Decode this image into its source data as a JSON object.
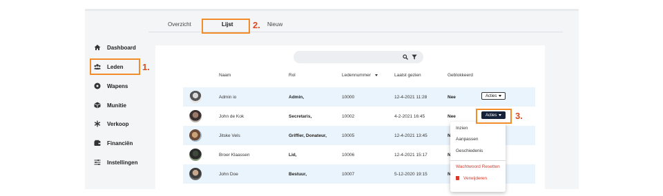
{
  "sidebar": {
    "items": [
      {
        "label": "Dashboard",
        "icon": "home-icon"
      },
      {
        "label": "Leden",
        "icon": "users-icon"
      },
      {
        "label": "Wapens",
        "icon": "target-icon"
      },
      {
        "label": "Munitie",
        "icon": "box-icon"
      },
      {
        "label": "Verkoop",
        "icon": "asterisk-icon"
      },
      {
        "label": "Financiën",
        "icon": "wallet-icon"
      },
      {
        "label": "Instellingen",
        "icon": "sliders-icon"
      }
    ]
  },
  "tabs": [
    {
      "label": "Overzicht"
    },
    {
      "label": "Lijst"
    },
    {
      "label": "Nieuw"
    }
  ],
  "table": {
    "columns": [
      "Naam",
      "Rol",
      "Ledennummer",
      "Laatst gezien",
      "Geblokkeerd"
    ],
    "rows": [
      {
        "name": "Admin io",
        "role": "Admin,",
        "number": "10000",
        "last_seen": "12-4-2021 11:28",
        "blocked": "Nee",
        "actions": "Acties"
      },
      {
        "name": "John de Kok",
        "role": "Secretaris,",
        "number": "10002",
        "last_seen": "4-2-2021 16:45",
        "blocked": "Nee",
        "actions": "Acties"
      },
      {
        "name": "Jitske Vels",
        "role": "Griffier, Donateur,",
        "number": "10005",
        "last_seen": "12-4-2021 13:45",
        "blocked": "N"
      },
      {
        "name": "Broer Klaassen",
        "role": "Lid,",
        "number": "10006",
        "last_seen": "12-4-2021 15:17",
        "blocked": "N"
      },
      {
        "name": "John Doe",
        "role": "Bestuur,",
        "number": "10007",
        "last_seen": "5-12-2020 19:15",
        "blocked": "N"
      }
    ]
  },
  "dropdown": {
    "items": [
      "Inzien",
      "Aanpassen",
      "Geschiedenis"
    ],
    "danger_items": [
      "Wachtwoord Resetten",
      "Verwijderen"
    ]
  },
  "annotations": [
    "1.",
    "2.",
    "3."
  ],
  "colors": {
    "accent_box": "#f28c28",
    "annotation_text": "#e04a1a",
    "row_highlight": "#eaf4fc",
    "danger": "#d63a2a",
    "button_dark": "#16213a"
  }
}
